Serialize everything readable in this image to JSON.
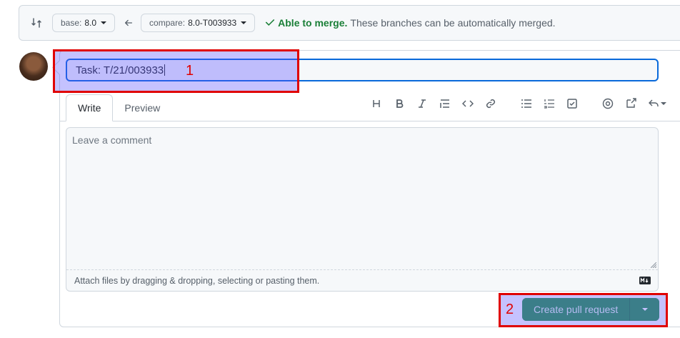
{
  "compare_bar": {
    "base_label": "base:",
    "base_value": "8.0",
    "compare_label": "compare:",
    "compare_value": "8.0-T003933",
    "merge_ok": "Able to merge.",
    "merge_text": "These branches can be automatically merged."
  },
  "form": {
    "title_value": "Task: T/21/003933",
    "tabs": [
      {
        "label": "Write"
      },
      {
        "label": "Preview"
      }
    ],
    "toolbar_icons": [
      "heading-icon",
      "bold-icon",
      "italic-icon",
      "quote-icon",
      "code-icon",
      "link-icon",
      "unordered-list-icon",
      "ordered-list-icon",
      "task-list-icon",
      "mention-icon",
      "cross-reference-icon",
      "reply-icon"
    ],
    "comment_placeholder": "Leave a comment",
    "attach_text": "Attach files by dragging & dropping, selecting or pasting them."
  },
  "submit": {
    "create_label": "Create pull request"
  },
  "annotations": [
    {
      "label": "1"
    },
    {
      "label": "2"
    }
  ],
  "colors": {
    "accent": "#0969da",
    "success": "#1a7f37",
    "button_green": "#2c974b",
    "annotation_red": "#e00000",
    "annotation_fill": "#5a50ff"
  }
}
